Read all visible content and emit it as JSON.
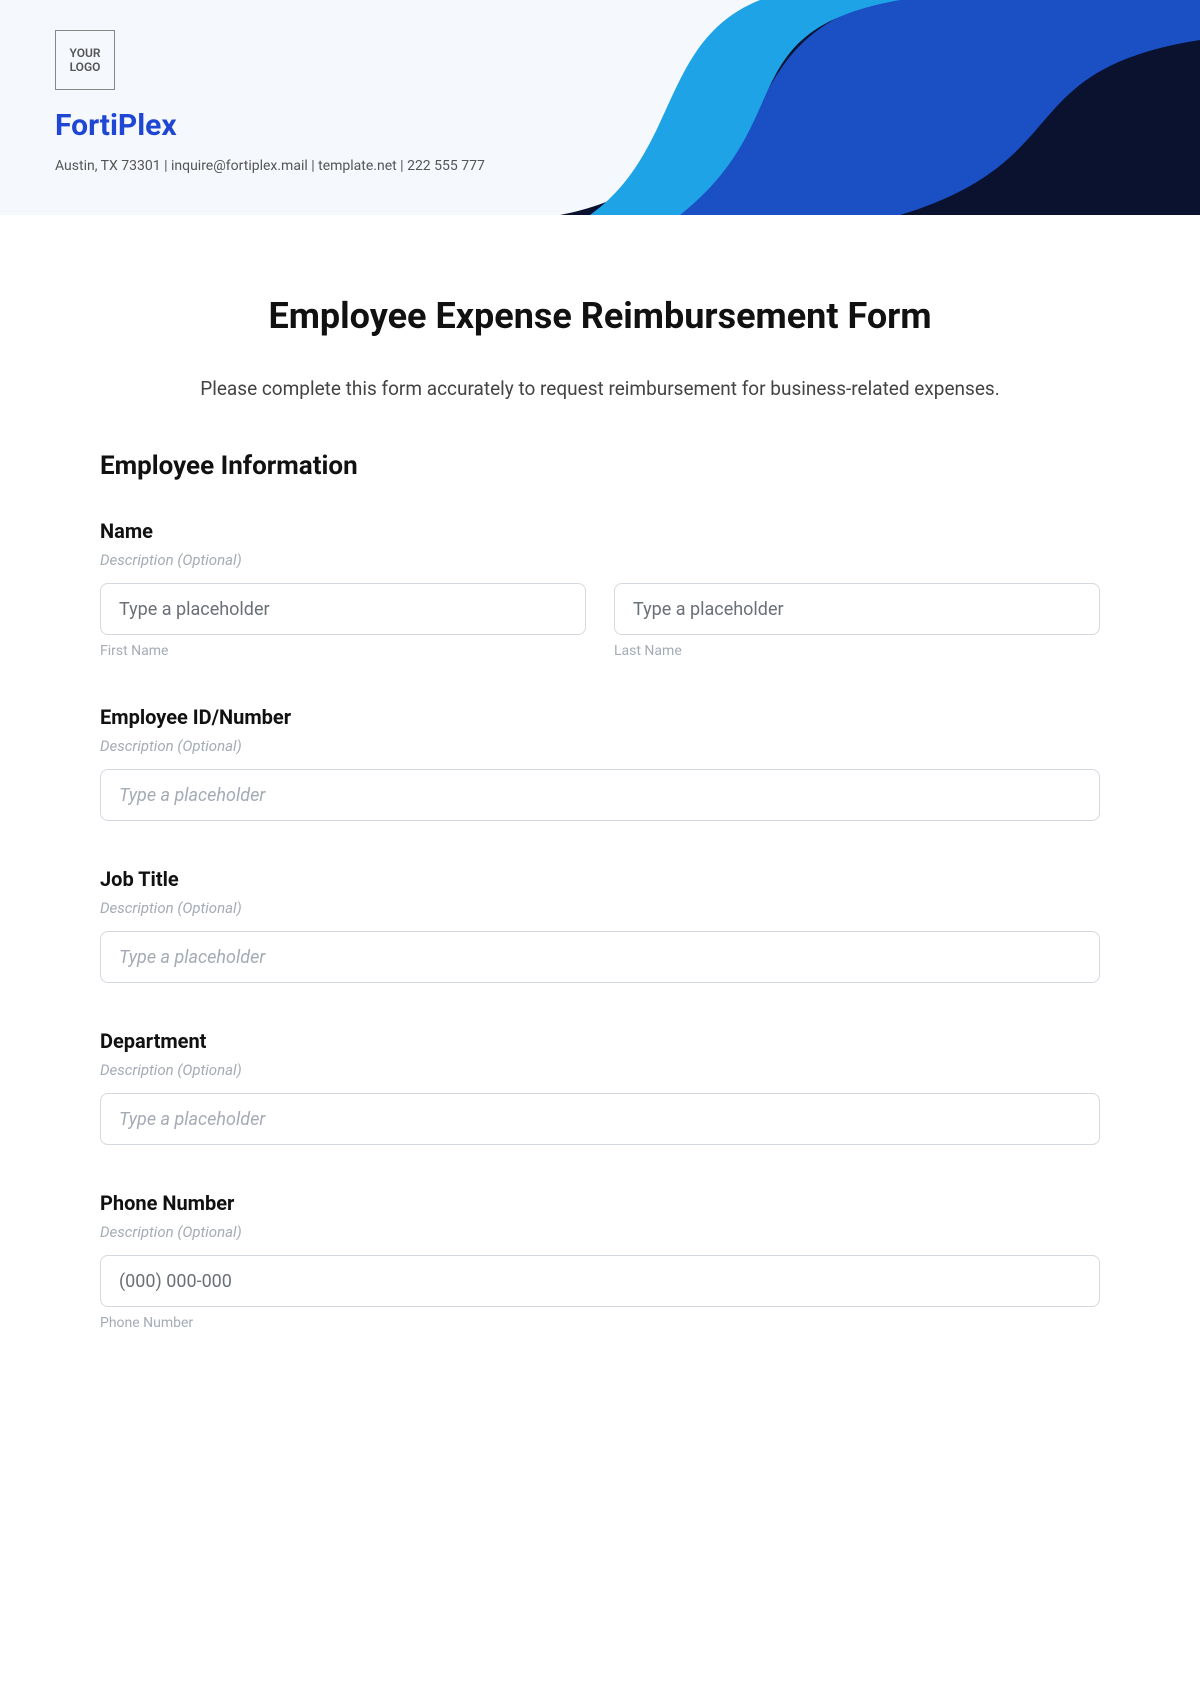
{
  "header": {
    "logo_text": "YOUR\nLOGO",
    "company_name": "FortiPlex",
    "info_line": "Austin, TX 73301 | inquire@fortiplex.mail | template.net | 222 555 777"
  },
  "form": {
    "title": "Employee Expense Reimbursement Form",
    "intro": "Please complete this form accurately to request reimbursement for business-related expenses.",
    "section_heading": "Employee Information",
    "desc_text": "Description (Optional)",
    "placeholder_text": "Type a placeholder",
    "fields": {
      "name": {
        "label": "Name",
        "first_sub": "First Name",
        "last_sub": "Last Name"
      },
      "employee_id": {
        "label": "Employee ID/Number"
      },
      "job_title": {
        "label": "Job Title"
      },
      "department": {
        "label": "Department"
      },
      "phone": {
        "label": "Phone Number",
        "placeholder": "(000) 000-000",
        "sub": "Phone Number"
      }
    }
  }
}
